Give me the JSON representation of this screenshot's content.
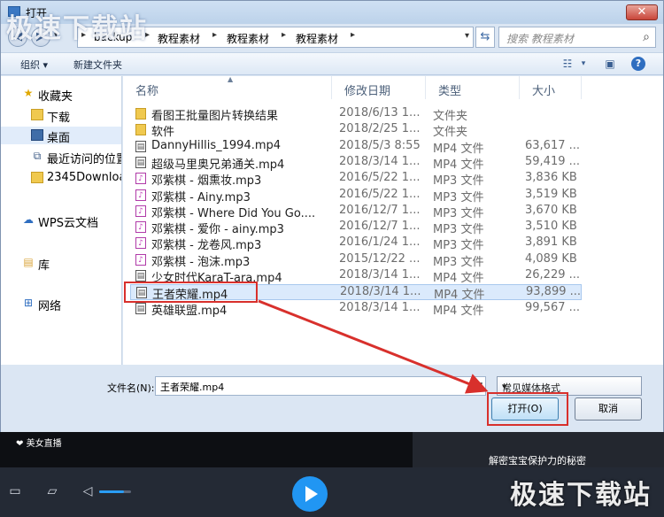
{
  "dialog": {
    "title": "打开",
    "close_label": "✕",
    "watermark": "极速下载站"
  },
  "address": {
    "crumbs": [
      "backup",
      "教程素材",
      "教程素材",
      "教程素材"
    ],
    "search_placeholder": "搜索 教程素材"
  },
  "toolbar": {
    "organize_label": "组织 ▾",
    "new_folder_label": "新建文件夹"
  },
  "nav": {
    "items": [
      {
        "label": "收藏夹",
        "icon": "star-icon"
      },
      {
        "label": "下载",
        "icon": "folder-icon"
      },
      {
        "label": "桌面",
        "icon": "desktop-icon"
      },
      {
        "label": "最近访问的位置",
        "icon": "recent-icon"
      },
      {
        "label": "2345Downloads",
        "icon": "folder-icon"
      },
      {
        "label": "WPS云文档",
        "icon": "cloud-icon"
      },
      {
        "label": "库",
        "icon": "library-icon"
      },
      {
        "label": "网络",
        "icon": "network-icon"
      }
    ]
  },
  "columns": {
    "name": "名称",
    "modified": "修改日期",
    "type": "类型",
    "size": "大小"
  },
  "files": [
    {
      "name": "看图王批量图片转换结果",
      "date": "2018/6/13 1...",
      "type": "文件夹",
      "size": "",
      "kind": "folder"
    },
    {
      "name": "软件",
      "date": "2018/2/25 1...",
      "type": "文件夹",
      "size": "",
      "kind": "folder"
    },
    {
      "name": "DannyHillis_1994.mp4",
      "date": "2018/5/3 8:55",
      "type": "MP4 文件",
      "size": "63,617 ...",
      "kind": "mp4"
    },
    {
      "name": "超级马里奥兄弟通关.mp4",
      "date": "2018/3/14 1...",
      "type": "MP4 文件",
      "size": "59,419 ...",
      "kind": "mp4"
    },
    {
      "name": "邓紫棋 - 烟熏妆.mp3",
      "date": "2016/5/22 1...",
      "type": "MP3 文件",
      "size": "3,836 KB",
      "kind": "mp3"
    },
    {
      "name": "邓紫棋 - Ainy.mp3",
      "date": "2016/5/22 1...",
      "type": "MP3 文件",
      "size": "3,519 KB",
      "kind": "mp3"
    },
    {
      "name": "邓紫棋 - Where Did You Go....",
      "date": "2016/12/7 1...",
      "type": "MP3 文件",
      "size": "3,670 KB",
      "kind": "mp3"
    },
    {
      "name": "邓紫棋 - 爱你 - ainy.mp3",
      "date": "2016/12/7 1...",
      "type": "MP3 文件",
      "size": "3,510 KB",
      "kind": "mp3"
    },
    {
      "name": "邓紫棋 - 龙卷风.mp3",
      "date": "2016/1/24 1...",
      "type": "MP3 文件",
      "size": "3,891 KB",
      "kind": "mp3"
    },
    {
      "name": "邓紫棋 - 泡沫.mp3",
      "date": "2015/12/22 ...",
      "type": "MP3 文件",
      "size": "4,089 KB",
      "kind": "mp3"
    },
    {
      "name": "少女时代KaraT-ara.mp4",
      "date": "2018/3/14 1...",
      "type": "MP4 文件",
      "size": "26,229 ...",
      "kind": "mp4"
    },
    {
      "name": "王者荣耀.mp4",
      "date": "2018/3/14 1...",
      "type": "MP4 文件",
      "size": "93,899 ...",
      "kind": "mp4",
      "selected": true
    },
    {
      "name": "英雄联盟.mp4",
      "date": "2018/3/14 1...",
      "type": "MP4 文件",
      "size": "99,567 ...",
      "kind": "mp4"
    }
  ],
  "filename": {
    "label": "文件名(N):",
    "value": "王者荣耀.mp4"
  },
  "filetype": {
    "selected": "常见媒体格式"
  },
  "buttons": {
    "open": "打开(O)",
    "cancel": "取消"
  },
  "player": {
    "video_title": "美女直播",
    "tip": "解密宝宝保护力的秘密",
    "watermark": "极速下载站"
  },
  "colors": {
    "annotation": "#d8302c",
    "accent": "#2196f3"
  }
}
